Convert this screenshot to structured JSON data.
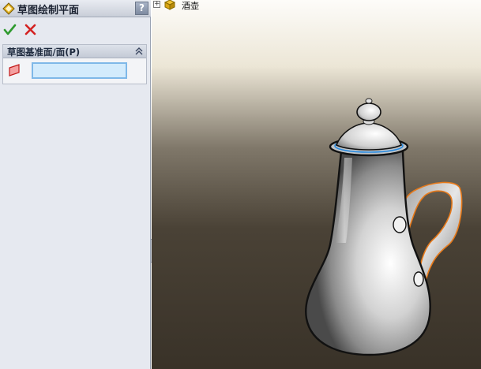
{
  "panel": {
    "title": "草图绘制平面",
    "help_label": "?",
    "icons": {
      "title": "sketch-plane-icon",
      "ok": "check-icon",
      "cancel": "x-icon"
    },
    "colors": {
      "ok": "#2e9a2e",
      "cancel": "#d42020",
      "input_border": "#7fb8e8",
      "input_bg": "#d3ebfc"
    }
  },
  "section": {
    "title": "草图基准面/面(P)",
    "input_value": ""
  },
  "tree": {
    "expand_label": "+",
    "item_label": "酒壶"
  },
  "model": {
    "highlight_color": "#e87a1a"
  }
}
